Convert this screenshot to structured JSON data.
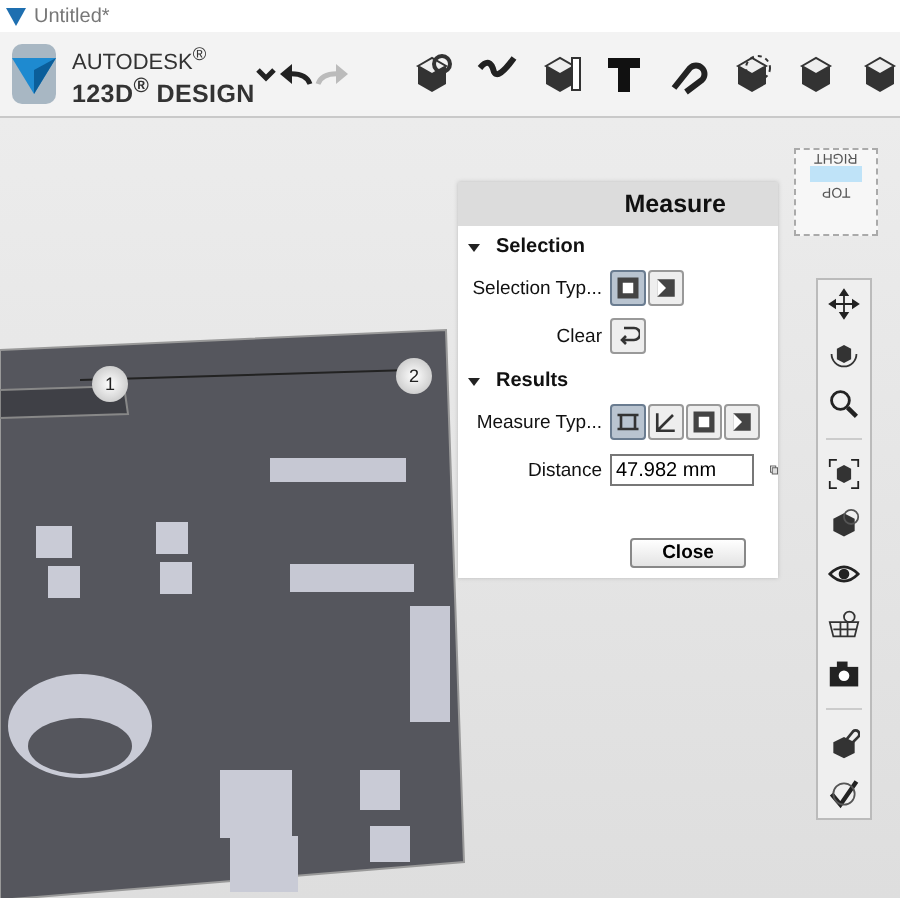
{
  "window": {
    "title": "Untitled*"
  },
  "logo": {
    "brand": "AUTODESK$^{®}$",
    "product": "123D$^{®}$ DESIGN"
  },
  "toolbar": {
    "undo": {
      "disabled": false
    },
    "redo": {
      "disabled": true
    }
  },
  "view_cube": {
    "faces": [
      "RIGHT",
      "TOP"
    ]
  },
  "markers": [
    "1",
    "2"
  ],
  "measure_panel": {
    "title": "Measure",
    "sections": [
      {
        "label": "Selection",
        "expanded": true,
        "rows": [
          {
            "kind": "icons",
            "label": "Selection Typ...",
            "options": [
              {
                "selected": true
              },
              {
                "selected": false
              }
            ]
          },
          {
            "kind": "button",
            "label": "Clear"
          }
        ]
      },
      {
        "label": "Results",
        "expanded": true,
        "rows": [
          {
            "kind": "icons",
            "label": "Measure Typ...",
            "options": [
              {
                "selected": true
              },
              {
                "selected": false
              },
              {
                "selected": false
              },
              {
                "selected": false
              }
            ]
          },
          {
            "kind": "field",
            "label": "Distance",
            "value": "47.982 mm"
          }
        ]
      }
    ],
    "close": "Close"
  }
}
